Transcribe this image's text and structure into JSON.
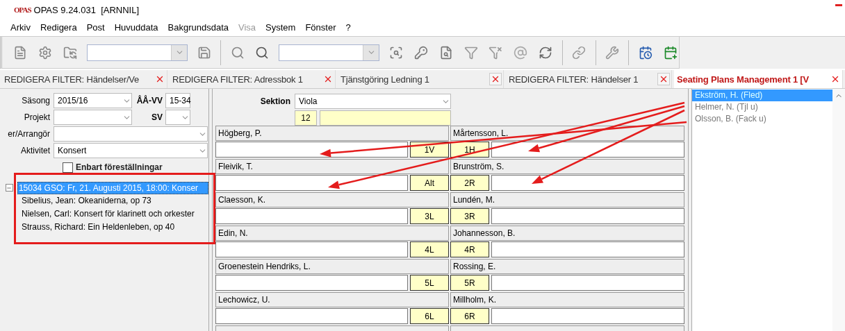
{
  "window": {
    "logo": "OPAS",
    "title": "OPAS 9.24.031  [ARNNIL]"
  },
  "menu": [
    {
      "label": "Arkiv",
      "disabled": false
    },
    {
      "label": "Redigera",
      "disabled": false
    },
    {
      "label": "Post",
      "disabled": false
    },
    {
      "label": "Huvuddata",
      "disabled": false
    },
    {
      "label": "Bakgrundsdata",
      "disabled": false
    },
    {
      "label": "Visa",
      "disabled": true
    },
    {
      "label": "System",
      "disabled": false
    },
    {
      "label": "Fönster",
      "disabled": false
    },
    {
      "label": "?",
      "disabled": false
    }
  ],
  "toolbar": [
    {
      "kind": "button"
    },
    {
      "kind": "button"
    },
    {
      "kind": "button"
    },
    {
      "kind": "combo"
    },
    {
      "kind": "button"
    },
    {
      "kind": "separator"
    },
    {
      "kind": "button"
    },
    {
      "kind": "button"
    },
    {
      "kind": "combo"
    },
    {
      "kind": "button"
    },
    {
      "kind": "button"
    },
    {
      "kind": "button"
    },
    {
      "kind": "button"
    },
    {
      "kind": "button"
    },
    {
      "kind": "button"
    },
    {
      "kind": "button"
    },
    {
      "kind": "separator"
    },
    {
      "kind": "button"
    },
    {
      "kind": "separator"
    },
    {
      "kind": "button"
    },
    {
      "kind": "separator"
    },
    {
      "kind": "button"
    },
    {
      "kind": "button"
    }
  ],
  "tabs": [
    {
      "label": "REDIGERA FILTER: Händelser/Ve",
      "kind": "plain",
      "selected": false
    },
    {
      "label": "REDIGERA FILTER: Adressbok  1",
      "kind": "plain",
      "selected": false
    },
    {
      "label": "Tjänstgöring Ledning  1",
      "kind": "boxed",
      "selected": false
    },
    {
      "label": "REDIGERA FILTER: Händelser  1",
      "kind": "boxed",
      "selected": false
    },
    {
      "label": "Seating Plans Management  1 [V",
      "kind": "plain",
      "selected": true
    }
  ],
  "filter": {
    "season": {
      "label": "Säsong",
      "value": "2015/16"
    },
    "week": {
      "label": "ÅÅ-VV",
      "value": "15-34"
    },
    "project": {
      "label": "Projekt"
    },
    "sv": {
      "label": "SV"
    },
    "organizer": {
      "label": "er/Arrangör"
    },
    "activity": {
      "label": "Aktivitet",
      "value": "Konsert"
    },
    "only_performances": {
      "label": "Enbart föreställningar",
      "checked": false
    }
  },
  "tree": [
    {
      "label": "15034 GSO: Fr, 21. Augusti  2015, 18:00: Konser",
      "selected": true,
      "expanded": true,
      "children": [
        {
          "label": "Sibelius, Jean: Okeaniderna, op 73",
          "selected": false
        },
        {
          "label": "Nielsen, Carl: Konsert för klarinett och orkester",
          "selected": false
        },
        {
          "label": "Strauss, Richard: Ein Heldenleben, op 40",
          "selected": false
        }
      ]
    }
  ],
  "section": {
    "label": "Sektion",
    "value": "Viola",
    "count": "12"
  },
  "seats": [
    {
      "left": {
        "name": "Högberg, P.",
        "position": "1V"
      },
      "right": {
        "name": "Mårtensson, L.",
        "position": "1H"
      }
    },
    {
      "left": {
        "name": "Fleivik, T.",
        "position": "Alt"
      },
      "right": {
        "name": "Brunström, S.",
        "position": "2R"
      }
    },
    {
      "left": {
        "name": "Claesson, K.",
        "position": "3L"
      },
      "right": {
        "name": "Lundén, M.",
        "position": "3R"
      }
    },
    {
      "left": {
        "name": "Edin, N.",
        "position": "4L"
      },
      "right": {
        "name": "Johannesson, B.",
        "position": "4R"
      }
    },
    {
      "left": {
        "name": "Groenestein Hendriks, L.",
        "position": "5L"
      },
      "right": {
        "name": "Rossing, E.",
        "position": "5R"
      }
    },
    {
      "left": {
        "name": "Lechowicz, U.",
        "position": "6L"
      },
      "right": {
        "name": "Millholm, K.",
        "position": "6R"
      }
    }
  ],
  "musicians": [
    {
      "name": "Ekström, H. (Fled)",
      "selected": true
    },
    {
      "name": "Helmer, N. (Tjl u)",
      "selected": false
    },
    {
      "name": "Olsson, B. (Fack u)",
      "selected": false
    }
  ]
}
